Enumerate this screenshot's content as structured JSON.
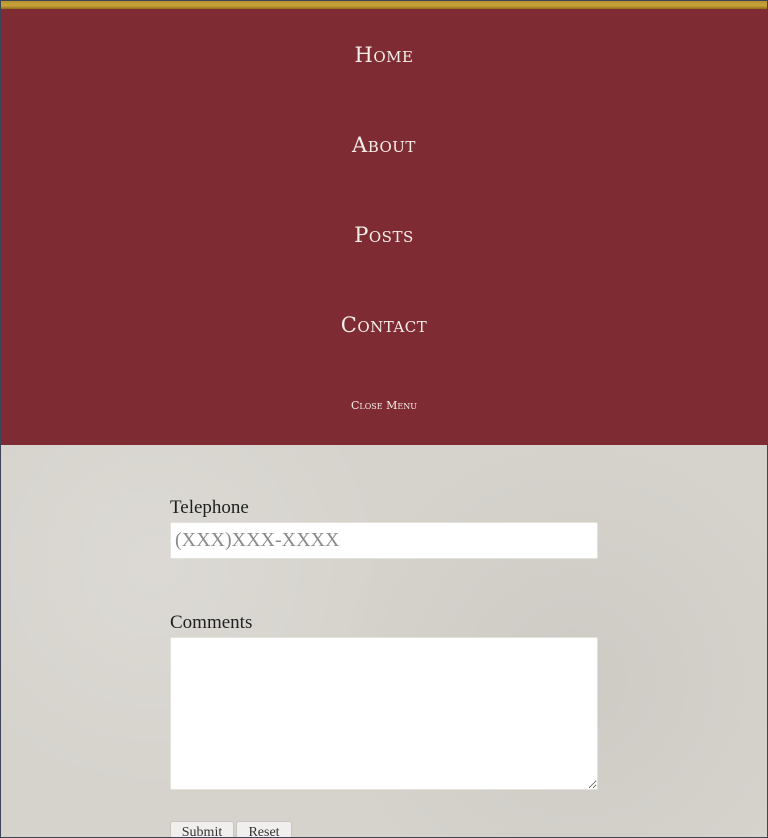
{
  "nav": {
    "items": [
      {
        "label": "Home"
      },
      {
        "label": "About"
      },
      {
        "label": "Posts"
      },
      {
        "label": "Contact"
      }
    ],
    "close_label": "Close Menu"
  },
  "form": {
    "telephone": {
      "label": "Telephone",
      "placeholder": "(XXX)XXX-XXXX",
      "value": ""
    },
    "comments": {
      "label": "Comments",
      "value": ""
    },
    "buttons": {
      "submit_label": "Submit",
      "reset_label": "Reset"
    }
  },
  "colors": {
    "menu_background": "#7f2b34",
    "accent_bar": "#c9a43a",
    "page_background": "#d6d3cd"
  }
}
